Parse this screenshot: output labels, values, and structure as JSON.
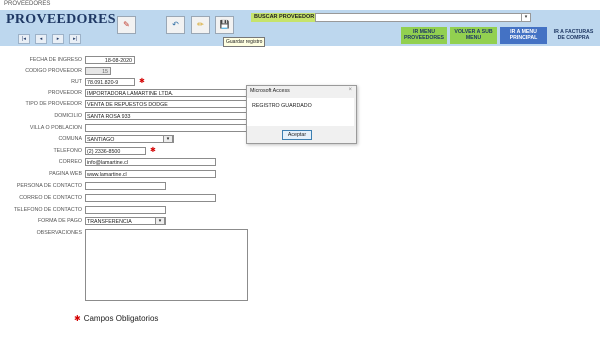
{
  "window": {
    "title": "PROVEEDORES"
  },
  "header": {
    "title": "PROVEEDORES",
    "nav": [
      {
        "name": "nav-first-icon",
        "glyph": "|◂"
      },
      {
        "name": "nav-prev-icon",
        "glyph": "◂"
      },
      {
        "name": "nav-next-icon",
        "glyph": "▸"
      },
      {
        "name": "nav-last-icon",
        "glyph": "▸|"
      }
    ],
    "toolbar": [
      {
        "name": "eraser-icon",
        "glyph": "✎"
      },
      {
        "name": "undo-icon",
        "glyph": "↶"
      },
      {
        "name": "edit-icon",
        "glyph": "✏"
      },
      {
        "name": "save-icon",
        "glyph": "💾"
      }
    ],
    "tooltip": "Guardar registro",
    "search_label": "BUSCAR PROVEEDOR",
    "search_value": "",
    "menu": [
      {
        "line1": "IR MENU",
        "line2": "PROVEEDORES",
        "color": "#92d050"
      },
      {
        "line1": "VOLVER A SUB",
        "line2": "MENU",
        "color": "#92d050"
      },
      {
        "line1": "IR A MENU",
        "line2": "PRINCIPAL",
        "color": "#4472c4"
      },
      {
        "line1": "IR A FACTURAS",
        "line2": "DE COMPRA",
        "color": "#bdd7ee"
      }
    ]
  },
  "form": {
    "fecha_ingreso": {
      "label": "FECHA DE INGRESO",
      "value": "18-08-2020"
    },
    "codigo": {
      "label": "CODIGO PROVEEDOR",
      "value": "15"
    },
    "rut": {
      "label": "RUT",
      "value": "78.091.820-9"
    },
    "proveedor": {
      "label": "PROVEEDOR",
      "value": "IMPORTADORA LAMARTINE LTDA."
    },
    "tipo": {
      "label": "TIPO DE PROVEEDOR",
      "value": "VENTA DE REPUESTOS DODGE"
    },
    "domicilio": {
      "label": "DOMICILIO",
      "value": "SANTA ROSA 933"
    },
    "villa": {
      "label": "VILLA O POBLACION",
      "value": ""
    },
    "comuna": {
      "label": "COMUNA",
      "value": "SANTIAGO"
    },
    "telefono": {
      "label": "TELEFONO",
      "value": "(2) 2336-8500"
    },
    "correo": {
      "label": "CORREO",
      "value": "info@lamartine.cl"
    },
    "web": {
      "label": "PAGINA WEB",
      "value": "www.lamartine.cl"
    },
    "persona": {
      "label": "PERSONA DE CONTACTO",
      "value": ""
    },
    "correo_contacto": {
      "label": "CORREO DE CONTACTO",
      "value": ""
    },
    "telefono_contacto": {
      "label": "TELEFONO DE CONTACTO",
      "value": ""
    },
    "forma_pago": {
      "label": "FORMA DE PAGO",
      "value": "TRANSFERENCIA"
    },
    "observaciones": {
      "label": "OBSERVACIONES",
      "value": ""
    }
  },
  "dialog": {
    "title": "Microsoft Access",
    "close": "×",
    "message": "REGISTRO GUARDADO",
    "ok": "Aceptar"
  },
  "legend": {
    "star": "✱",
    "text": "Campos Obligatorios"
  },
  "colors": {
    "header_bg": "#bdd7ee",
    "search_label_bg": "#c6e36b",
    "required": "#d40000",
    "title": "#1f3864"
  }
}
